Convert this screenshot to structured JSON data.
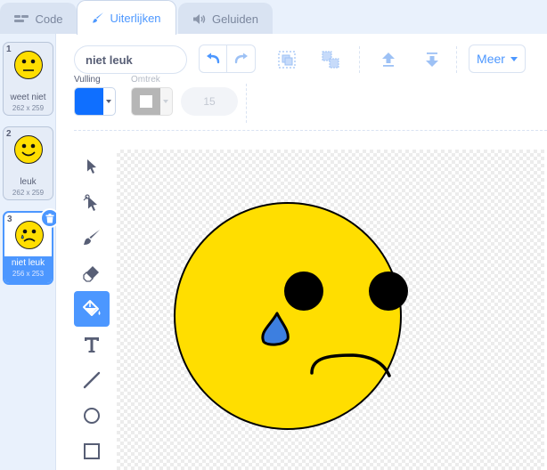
{
  "tabs": [
    {
      "label": "Code",
      "icon": "code-icon"
    },
    {
      "label": "Uiterlijken",
      "icon": "paintbrush-icon"
    },
    {
      "label": "Geluiden",
      "icon": "speaker-icon"
    }
  ],
  "costumes": [
    {
      "number": "1",
      "name": "weet niet",
      "size": "262 x 259",
      "face": "neutral"
    },
    {
      "number": "2",
      "name": "leuk",
      "size": "262 x 259",
      "face": "happy"
    },
    {
      "number": "3",
      "name": "niet leuk",
      "size": "256 x 253",
      "face": "sad",
      "selected": true
    }
  ],
  "toolbar": {
    "costume_name": "niet leuk",
    "more_label": "Meer",
    "fill_label": "Vulling",
    "outline_label": "Omtrek",
    "outline_width": "15"
  },
  "colors": {
    "accent": "#4c97ff",
    "fill": "#0f6fff",
    "face": "#ffde00",
    "tear": "#3d7fe0"
  },
  "tools": [
    "select-tool",
    "reshape-tool",
    "brush-tool",
    "eraser-tool",
    "fill-tool",
    "text-tool",
    "line-tool",
    "circle-tool",
    "rectangle-tool"
  ]
}
